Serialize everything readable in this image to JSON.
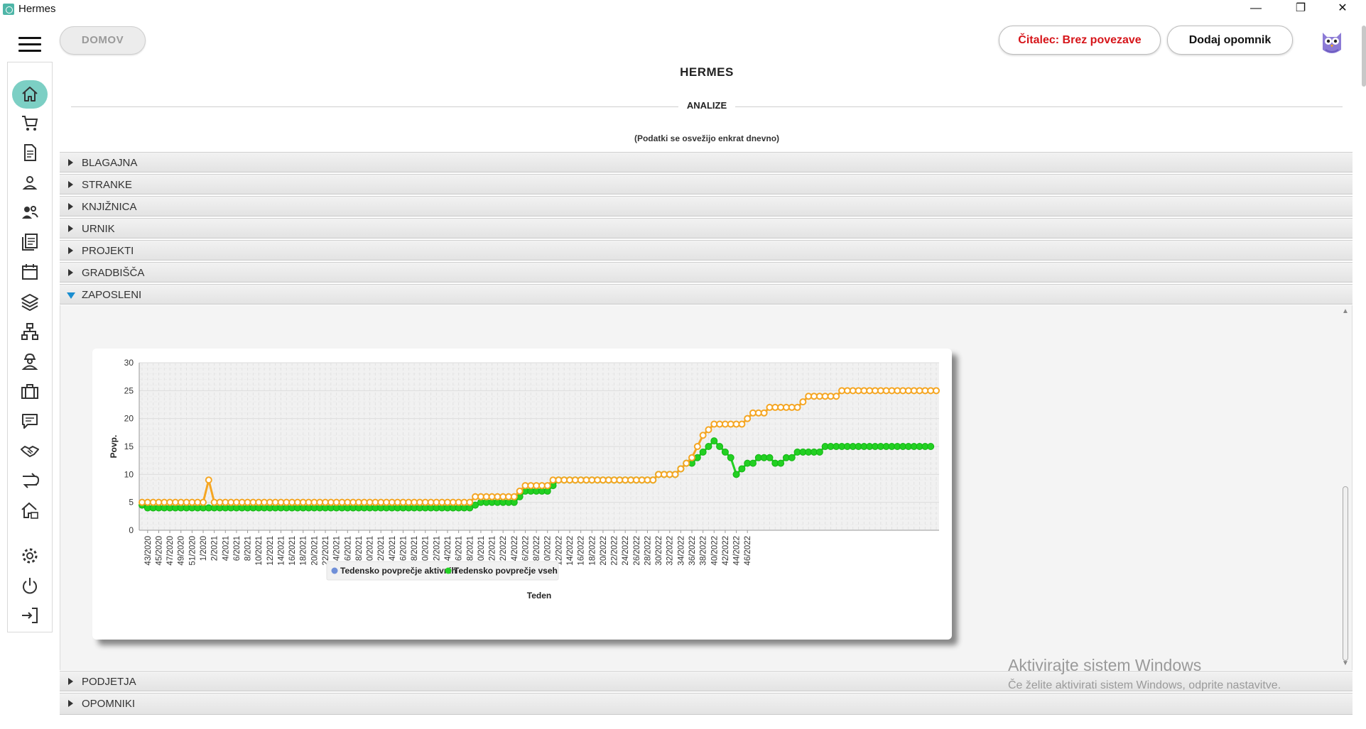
{
  "window": {
    "title": "Hermes",
    "minimize": "—",
    "restore": "❐",
    "close": "✕"
  },
  "header": {
    "home_button": "DOMOV",
    "reader_status": "Čitalec: Brez povezave",
    "add_reminder": "Dodaj opomnik"
  },
  "sidebar": {
    "items": [
      "home-icon",
      "cart-icon",
      "document-icon",
      "person-icon",
      "people-icon",
      "notes-icon",
      "calendar-icon",
      "layers-icon",
      "hierarchy-icon",
      "worker-icon",
      "briefcase-icon",
      "chat-icon",
      "handshake-icon",
      "transfer-icon",
      "house-icon",
      "settings-icon",
      "power-icon",
      "logout-icon"
    ]
  },
  "page": {
    "title": "HERMES",
    "section": "ANALIZE",
    "note": "(Podatki se osvežijo enkrat dnevno)"
  },
  "accordion": {
    "blagajna": "BLAGAJNA",
    "stranke": "STRANKE",
    "knjiznica": "KNJIŽNICA",
    "urnik": "URNIK",
    "projekti": "PROJEKTI",
    "gradbisca": "GRADBIŠČA",
    "zaposleni": "ZAPOSLENI",
    "podjetja": "PODJETJA",
    "opomniki": "OPOMNIKI"
  },
  "chart_data": {
    "type": "line",
    "xlabel": "Teden",
    "ylabel": "Povp.",
    "ylim": [
      0,
      30
    ],
    "yticks": [
      0,
      5,
      10,
      15,
      20,
      25,
      30
    ],
    "grid": true,
    "legend_position": "bottom",
    "x_labels": [
      "43/2020",
      "45/2020",
      "47/2020",
      "49/2020",
      "51/2020",
      "1/2020",
      "2/2021",
      "4/2021",
      "6/2021",
      "8/2021",
      "10/2021",
      "12/2021",
      "14/2021",
      "16/2021",
      "18/2021",
      "20/2021",
      "22/2021",
      "24/2021",
      "26/2021",
      "28/2021",
      "30/2021",
      "32/2021",
      "34/2021",
      "36/2021",
      "38/2021",
      "40/2021",
      "42/2021",
      "44/2021",
      "46/2021",
      "48/2021",
      "50/2021",
      "52/2021",
      "2/2022",
      "4/2022",
      "6/2022",
      "8/2022",
      "10/2022",
      "12/2022",
      "14/2022",
      "16/2022",
      "18/2022",
      "20/2022",
      "22/2022",
      "24/2022",
      "26/2022",
      "28/2022",
      "30/2022",
      "32/2022",
      "34/2022",
      "36/2022",
      "38/2022",
      "40/2022",
      "42/2022",
      "44/2022",
      "46/2022"
    ],
    "series": [
      {
        "name": "Tedensko povprečje aktivnih",
        "color": "#f5a623",
        "legend_color": "#6f8fd8",
        "values": [
          5,
          5,
          5,
          5,
          5,
          5,
          5,
          5,
          5,
          5,
          5,
          5,
          9,
          5,
          5,
          5,
          5,
          5,
          5,
          5,
          5,
          5,
          5,
          5,
          5,
          5,
          5,
          5,
          5,
          5,
          5,
          5,
          5,
          5,
          5,
          5,
          5,
          5,
          5,
          5,
          5,
          5,
          5,
          5,
          5,
          5,
          5,
          5,
          5,
          5,
          5,
          5,
          5,
          5,
          5,
          5,
          5,
          5,
          5,
          5,
          6,
          6,
          6,
          6,
          6,
          6,
          6,
          6,
          7,
          8,
          8,
          8,
          8,
          8,
          9,
          9,
          9,
          9,
          9,
          9,
          9,
          9,
          9,
          9,
          9,
          9,
          9,
          9,
          9,
          9,
          9,
          9,
          9,
          10,
          10,
          10,
          10,
          11,
          12,
          13,
          15,
          17,
          18,
          19,
          19,
          19,
          19,
          19,
          19,
          20,
          21,
          21,
          21,
          22,
          22,
          22,
          22,
          22,
          22,
          23,
          24,
          24,
          24,
          24,
          24,
          24,
          25,
          25,
          25,
          25,
          25,
          25,
          25,
          25,
          25,
          25,
          25,
          25,
          25,
          25,
          25,
          25,
          25,
          25
        ]
      },
      {
        "name": "Tedensko povprečje vseh",
        "color": "#22d022",
        "legend_color": "#22d022",
        "values": [
          4.5,
          4,
          4,
          4,
          4,
          4,
          4,
          4,
          4,
          4,
          4,
          4,
          4,
          4,
          4,
          4,
          4,
          4,
          4,
          4,
          4,
          4,
          4,
          4,
          4,
          4,
          4,
          4,
          4,
          4,
          4,
          4,
          4,
          4,
          4,
          4,
          4,
          4,
          4,
          4,
          4,
          4,
          4,
          4,
          4,
          4,
          4,
          4,
          4,
          4,
          4,
          4,
          4,
          4,
          4,
          4,
          4,
          4,
          4,
          4,
          4.5,
          5,
          5,
          5,
          5,
          5,
          5,
          5,
          6,
          7,
          7,
          7,
          7,
          7,
          8,
          9,
          9,
          9,
          9,
          9,
          9,
          9,
          9,
          9,
          9,
          9,
          9,
          9,
          9,
          9,
          9,
          9,
          9,
          10,
          10,
          10,
          10,
          11,
          12,
          12,
          13,
          14,
          15,
          16,
          15,
          14,
          13,
          10,
          11,
          12,
          12,
          13,
          13,
          13,
          12,
          12,
          13,
          13,
          14,
          14,
          14,
          14,
          14,
          15,
          15,
          15,
          15,
          15,
          15,
          15,
          15,
          15,
          15,
          15,
          15,
          15,
          15,
          15,
          15,
          15,
          15,
          15,
          15
        ]
      }
    ]
  },
  "watermark": {
    "line1": "Aktivirajte sistem Windows",
    "line2": "Če želite aktivirati sistem Windows, odprite nastavitve."
  }
}
